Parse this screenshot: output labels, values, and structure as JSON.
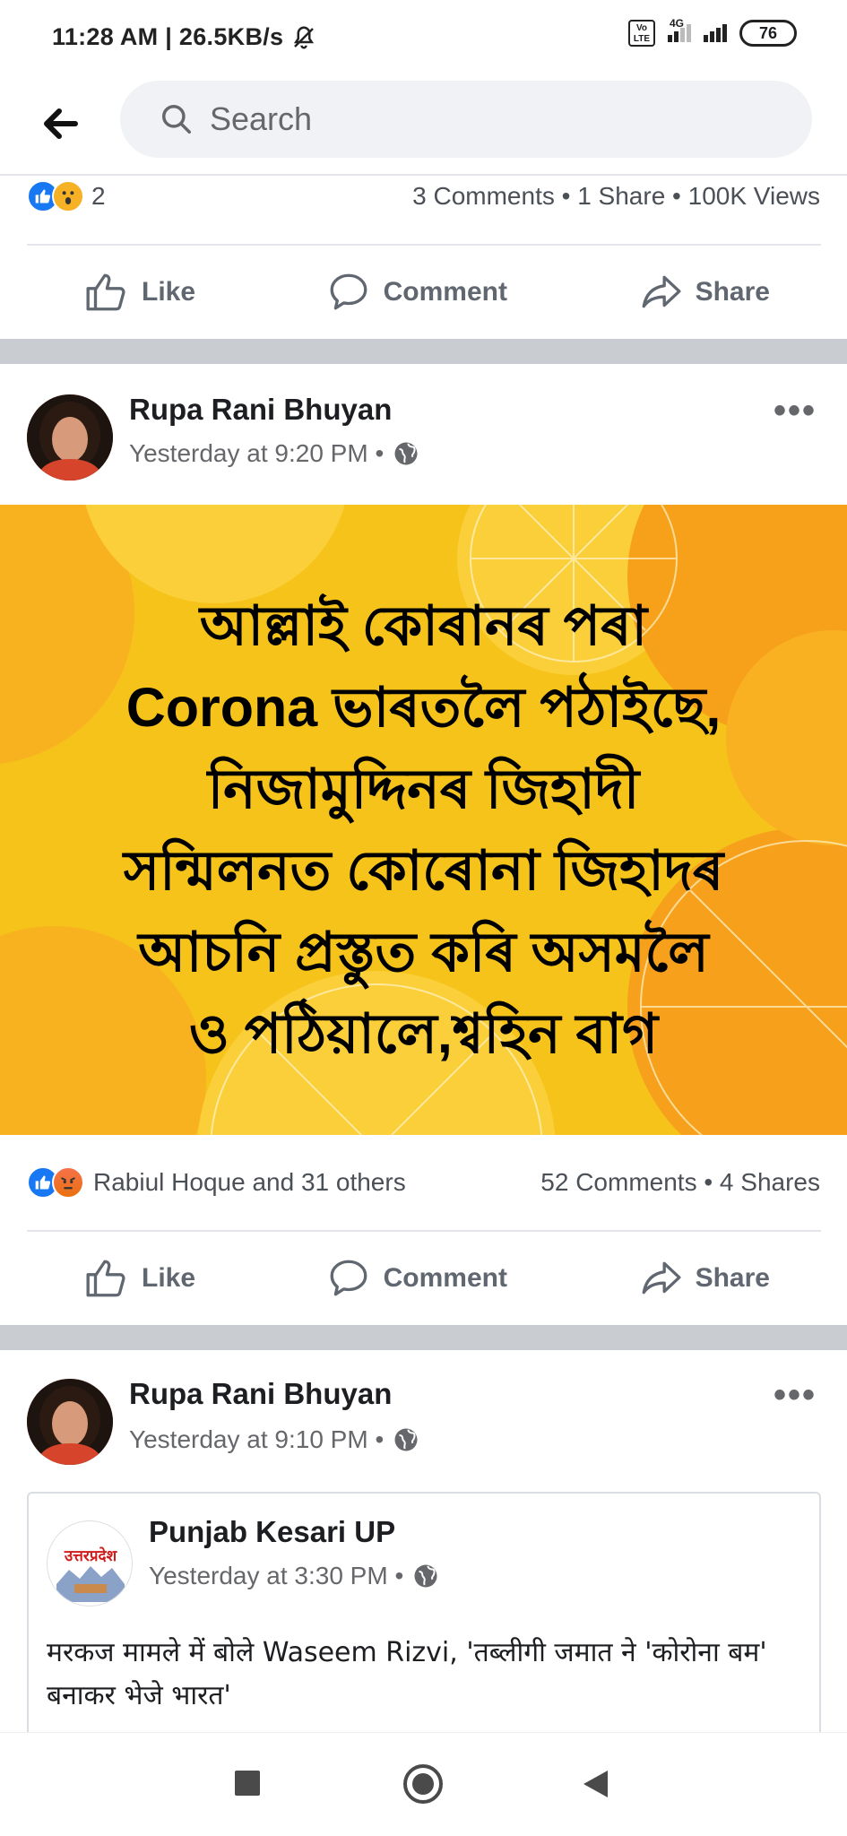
{
  "status": {
    "time_speed": "11:28 AM | 26.5KB/s",
    "volte": "Vo LTE",
    "network": "4G",
    "battery": "76"
  },
  "topbar": {
    "search_placeholder": "Search"
  },
  "post0": {
    "reaction_count": "2",
    "stats": "3 Comments • 1 Share • 100K Views",
    "like_label": "Like",
    "comment_label": "Comment",
    "share_label": "Share"
  },
  "post1": {
    "author": "Rupa Rani Bhuyan",
    "time": "Yesterday at 9:20 PM •",
    "image_lines": [
      "আল্লাই কোৰানৰ পৰা",
      "Corona  ভাৰতলৈ পঠাইছে,",
      "নিজামুদ্দিনৰ জিহাদী",
      "সন্মিলনত কোৰোনা জিহাদৰ",
      "আচনি প্ৰস্তুত কৰি অসমলৈ",
      "ও পঠিয়ালে,শ্বহিন বাগ"
    ],
    "reactors": "Rabiul Hoque and 31 others",
    "stats": "52 Comments • 4 Shares",
    "like_label": "Like",
    "comment_label": "Comment",
    "share_label": "Share"
  },
  "post2": {
    "author": "Rupa Rani Bhuyan",
    "time": "Yesterday at 9:10 PM •",
    "shared": {
      "page_name": "Punjab Kesari UP",
      "logo_text": "उत्तरप्रदेश",
      "time": "Yesterday at 3:30 PM •",
      "text": "मरकज मामले में बोले Waseem Rizvi, 'तब्लीगी जमात ने 'कोरोना बम' बनाकर भेजे भारत'"
    }
  },
  "colors": {
    "facebook_blue": "#1877f2",
    "post_image_bg": "#f6c31a",
    "separator": "#c9ccd1"
  }
}
